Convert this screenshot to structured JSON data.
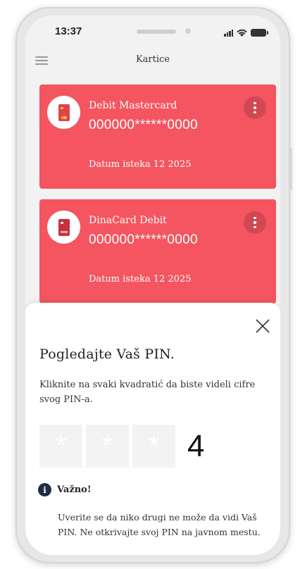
{
  "status_bar": {
    "time": "13:37"
  },
  "header": {
    "title": "Kartice"
  },
  "cards": [
    {
      "name": "Debit Mastercard",
      "number": "000000******0000",
      "expiry": "Datum isteka 12 2025"
    },
    {
      "name": "DinaCard Debit",
      "number": "000000******0000",
      "expiry": "Datum isteka 12 2025"
    }
  ],
  "pin_sheet": {
    "title": "Pogledajte Vaš PIN.",
    "description": "Kliknite na svaki kvadratić da biste videli cifre svog PIN-a.",
    "pin_boxes": [
      "*",
      "*",
      "*"
    ],
    "revealed_digit": "4",
    "important_label": "Važno!",
    "warning": "Uverite se da niko drugi ne može da vidi Vaš PIN. Ne otkrivajte svoj PIN na javnom mestu."
  },
  "colors": {
    "card": "#f45560",
    "card_button": "#d24852",
    "info_icon": "#1f2c44"
  },
  "icons": {
    "menu": "hamburger-menu-icon",
    "more": "vertical-dots-icon",
    "close": "close-icon",
    "info": "info-icon"
  }
}
